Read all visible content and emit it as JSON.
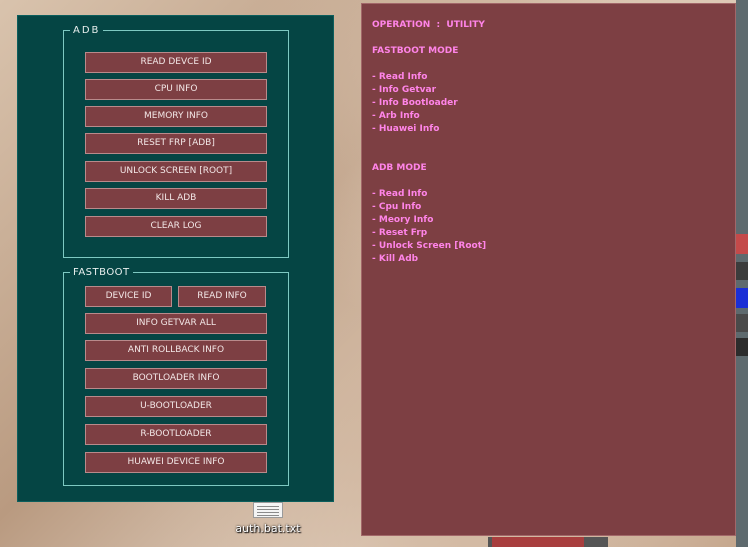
{
  "adb": {
    "title": "ADB",
    "buttons": [
      "READ DEVCE ID",
      "CPU INFO",
      "MEMORY INFO",
      "RESET FRP [ADB]",
      "UNLOCK SCREEN [ROOT]",
      "KILL ADB",
      "CLEAR LOG"
    ]
  },
  "fastboot": {
    "title": "FASTBOOT",
    "device_id": "DEVICE ID",
    "read_info": "READ INFO",
    "buttons": [
      "INFO GETVAR ALL",
      "ANTI ROLLBACK INFO",
      "BOOTLOADER INFO",
      "U-BOOTLOADER",
      "R-BOOTLOADER",
      "HUAWEI DEVICE INFO"
    ]
  },
  "log": {
    "lines": [
      "OPERATION  :  UTILITY",
      "",
      "FASTBOOT MODE",
      "",
      "- Read Info",
      "- Info Getvar",
      "- Info Bootloader",
      "- Arb Info",
      "- Huawei Info",
      "",
      "",
      "ADB MODE",
      "",
      "- Read Info",
      "- Cpu Info",
      "- Meory Info",
      "- Reset Frp",
      "- Unlock Screen [Root]",
      "- Kill Adb"
    ]
  },
  "desktop": {
    "file_label": "auth.bat.txt"
  }
}
